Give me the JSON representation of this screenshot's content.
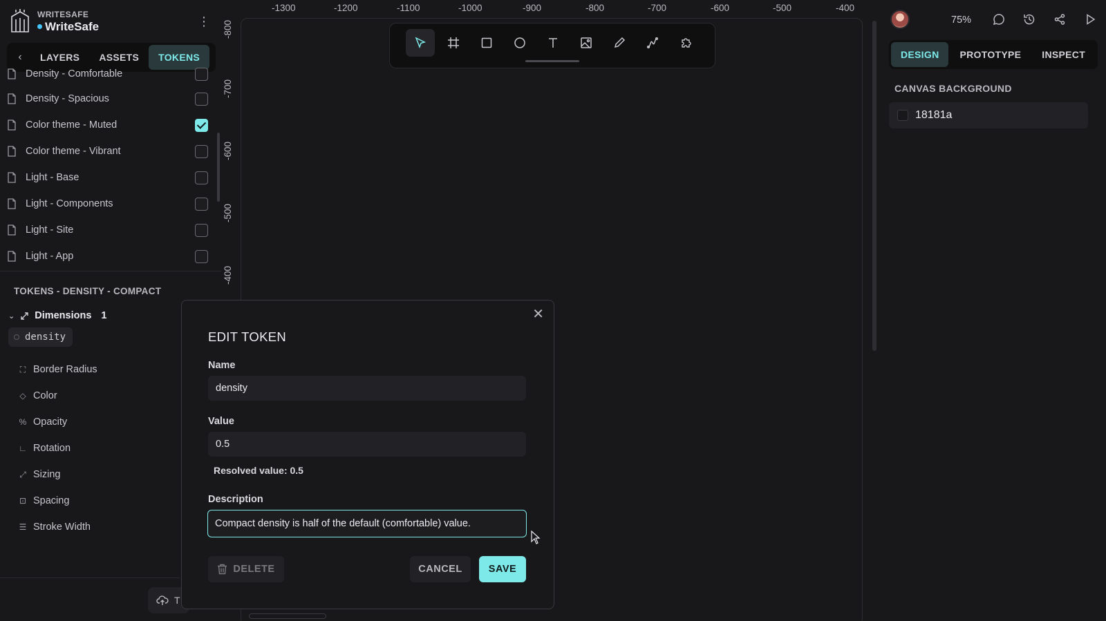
{
  "app": {
    "org": "WRITESAFE",
    "project": "WriteSafe"
  },
  "left_tabs": [
    {
      "label": "LAYERS",
      "active": false
    },
    {
      "label": "ASSETS",
      "active": false
    },
    {
      "label": "TOKENS",
      "active": true
    }
  ],
  "token_sets": [
    {
      "label": "Density - Comfortable",
      "checked": false
    },
    {
      "label": "Density - Spacious",
      "checked": false
    },
    {
      "label": "Color theme - Muted",
      "checked": true
    },
    {
      "label": "Color theme - Vibrant",
      "checked": false
    },
    {
      "label": "Light - Base",
      "checked": false
    },
    {
      "label": "Light - Components",
      "checked": false
    },
    {
      "label": "Light - Site",
      "checked": false
    },
    {
      "label": "Light - App",
      "checked": false
    }
  ],
  "tokens_panel": {
    "title": "TOKENS - DENSITY - COMPACT",
    "group": {
      "label": "Dimensions",
      "count": "1"
    },
    "token_pill": "density",
    "types": [
      "Border Radius",
      "Color",
      "Opacity",
      "Rotation",
      "Sizing",
      "Spacing",
      "Stroke Width"
    ],
    "import_label": "T"
  },
  "ruler": {
    "top": [
      "-1300",
      "-1200",
      "-1100",
      "-1000",
      "-900",
      "-800",
      "-700",
      "-600",
      "-500",
      "-400"
    ],
    "left": [
      "-800",
      "-700",
      "-600",
      "-500",
      "-400"
    ]
  },
  "toolbar": {
    "tools": [
      "move-tool",
      "board-tool",
      "rectangle-tool",
      "ellipse-tool",
      "text-tool",
      "image-tool",
      "pencil-tool",
      "path-tool",
      "plugins-tool"
    ],
    "active": "move-tool"
  },
  "header": {
    "zoom": "75%"
  },
  "right_tabs": [
    {
      "label": "DESIGN",
      "active": true
    },
    {
      "label": "PROTOTYPE",
      "active": false
    },
    {
      "label": "INSPECT",
      "active": false
    }
  ],
  "canvas_background": {
    "title": "CANVAS BACKGROUND",
    "value": "18181a",
    "color": "#18181a"
  },
  "modal": {
    "title": "EDIT TOKEN",
    "name_label": "Name",
    "name_value": "density",
    "value_label": "Value",
    "value_value": "0.5",
    "resolved": "Resolved value: 0.5",
    "description_label": "Description",
    "description_value": "Compact density is half of the default (comfortable) value.",
    "delete_label": "DELETE",
    "cancel_label": "CANCEL",
    "save_label": "SAVE"
  },
  "colors": {
    "accent": "#7ee9e9",
    "background": "#18181a",
    "panel": "#0f0f10",
    "field": "#222226"
  }
}
